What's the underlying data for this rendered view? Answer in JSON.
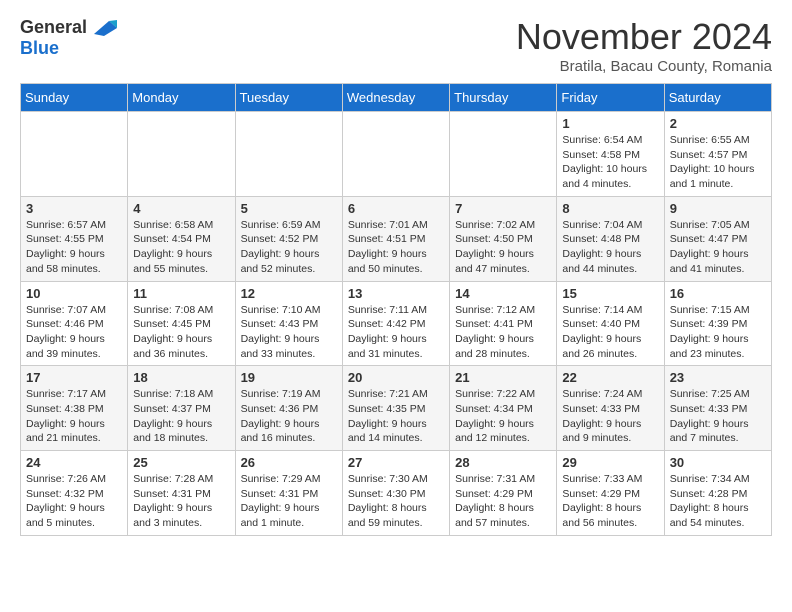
{
  "header": {
    "logo_general": "General",
    "logo_blue": "Blue",
    "month_title": "November 2024",
    "location": "Bratila, Bacau County, Romania"
  },
  "days_of_week": [
    "Sunday",
    "Monday",
    "Tuesday",
    "Wednesday",
    "Thursday",
    "Friday",
    "Saturday"
  ],
  "weeks": [
    [
      {
        "day": "",
        "info": ""
      },
      {
        "day": "",
        "info": ""
      },
      {
        "day": "",
        "info": ""
      },
      {
        "day": "",
        "info": ""
      },
      {
        "day": "",
        "info": ""
      },
      {
        "day": "1",
        "info": "Sunrise: 6:54 AM\nSunset: 4:58 PM\nDaylight: 10 hours\nand 4 minutes."
      },
      {
        "day": "2",
        "info": "Sunrise: 6:55 AM\nSunset: 4:57 PM\nDaylight: 10 hours\nand 1 minute."
      }
    ],
    [
      {
        "day": "3",
        "info": "Sunrise: 6:57 AM\nSunset: 4:55 PM\nDaylight: 9 hours\nand 58 minutes."
      },
      {
        "day": "4",
        "info": "Sunrise: 6:58 AM\nSunset: 4:54 PM\nDaylight: 9 hours\nand 55 minutes."
      },
      {
        "day": "5",
        "info": "Sunrise: 6:59 AM\nSunset: 4:52 PM\nDaylight: 9 hours\nand 52 minutes."
      },
      {
        "day": "6",
        "info": "Sunrise: 7:01 AM\nSunset: 4:51 PM\nDaylight: 9 hours\nand 50 minutes."
      },
      {
        "day": "7",
        "info": "Sunrise: 7:02 AM\nSunset: 4:50 PM\nDaylight: 9 hours\nand 47 minutes."
      },
      {
        "day": "8",
        "info": "Sunrise: 7:04 AM\nSunset: 4:48 PM\nDaylight: 9 hours\nand 44 minutes."
      },
      {
        "day": "9",
        "info": "Sunrise: 7:05 AM\nSunset: 4:47 PM\nDaylight: 9 hours\nand 41 minutes."
      }
    ],
    [
      {
        "day": "10",
        "info": "Sunrise: 7:07 AM\nSunset: 4:46 PM\nDaylight: 9 hours\nand 39 minutes."
      },
      {
        "day": "11",
        "info": "Sunrise: 7:08 AM\nSunset: 4:45 PM\nDaylight: 9 hours\nand 36 minutes."
      },
      {
        "day": "12",
        "info": "Sunrise: 7:10 AM\nSunset: 4:43 PM\nDaylight: 9 hours\nand 33 minutes."
      },
      {
        "day": "13",
        "info": "Sunrise: 7:11 AM\nSunset: 4:42 PM\nDaylight: 9 hours\nand 31 minutes."
      },
      {
        "day": "14",
        "info": "Sunrise: 7:12 AM\nSunset: 4:41 PM\nDaylight: 9 hours\nand 28 minutes."
      },
      {
        "day": "15",
        "info": "Sunrise: 7:14 AM\nSunset: 4:40 PM\nDaylight: 9 hours\nand 26 minutes."
      },
      {
        "day": "16",
        "info": "Sunrise: 7:15 AM\nSunset: 4:39 PM\nDaylight: 9 hours\nand 23 minutes."
      }
    ],
    [
      {
        "day": "17",
        "info": "Sunrise: 7:17 AM\nSunset: 4:38 PM\nDaylight: 9 hours\nand 21 minutes."
      },
      {
        "day": "18",
        "info": "Sunrise: 7:18 AM\nSunset: 4:37 PM\nDaylight: 9 hours\nand 18 minutes."
      },
      {
        "day": "19",
        "info": "Sunrise: 7:19 AM\nSunset: 4:36 PM\nDaylight: 9 hours\nand 16 minutes."
      },
      {
        "day": "20",
        "info": "Sunrise: 7:21 AM\nSunset: 4:35 PM\nDaylight: 9 hours\nand 14 minutes."
      },
      {
        "day": "21",
        "info": "Sunrise: 7:22 AM\nSunset: 4:34 PM\nDaylight: 9 hours\nand 12 minutes."
      },
      {
        "day": "22",
        "info": "Sunrise: 7:24 AM\nSunset: 4:33 PM\nDaylight: 9 hours\nand 9 minutes."
      },
      {
        "day": "23",
        "info": "Sunrise: 7:25 AM\nSunset: 4:33 PM\nDaylight: 9 hours\nand 7 minutes."
      }
    ],
    [
      {
        "day": "24",
        "info": "Sunrise: 7:26 AM\nSunset: 4:32 PM\nDaylight: 9 hours\nand 5 minutes."
      },
      {
        "day": "25",
        "info": "Sunrise: 7:28 AM\nSunset: 4:31 PM\nDaylight: 9 hours\nand 3 minutes."
      },
      {
        "day": "26",
        "info": "Sunrise: 7:29 AM\nSunset: 4:31 PM\nDaylight: 9 hours\nand 1 minute."
      },
      {
        "day": "27",
        "info": "Sunrise: 7:30 AM\nSunset: 4:30 PM\nDaylight: 8 hours\nand 59 minutes."
      },
      {
        "day": "28",
        "info": "Sunrise: 7:31 AM\nSunset: 4:29 PM\nDaylight: 8 hours\nand 57 minutes."
      },
      {
        "day": "29",
        "info": "Sunrise: 7:33 AM\nSunset: 4:29 PM\nDaylight: 8 hours\nand 56 minutes."
      },
      {
        "day": "30",
        "info": "Sunrise: 7:34 AM\nSunset: 4:28 PM\nDaylight: 8 hours\nand 54 minutes."
      }
    ]
  ]
}
